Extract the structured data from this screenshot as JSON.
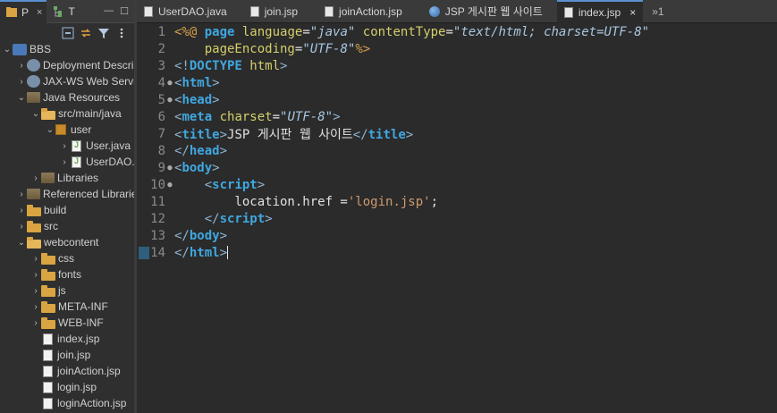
{
  "left_panel": {
    "tabs": [
      {
        "label": "P",
        "active": true,
        "close": "×"
      },
      {
        "label": "T",
        "active": false
      }
    ]
  },
  "tree": [
    {
      "label": "BBS",
      "arrow": "v",
      "icon": "project-icon",
      "indent": 0
    },
    {
      "label": "Deployment Descriptor",
      "arrow": ">",
      "icon": "deployment-icon",
      "indent": 1
    },
    {
      "label": "JAX-WS Web Services",
      "arrow": ">",
      "icon": "webservice-icon",
      "indent": 1
    },
    {
      "label": "Java Resources",
      "arrow": "v",
      "icon": "java-resources-icon",
      "indent": 1
    },
    {
      "label": "src/main/java",
      "arrow": "v",
      "icon": "source-folder-icon",
      "indent": 2
    },
    {
      "label": "user",
      "arrow": "v",
      "icon": "package-icon",
      "indent": 3
    },
    {
      "label": "User.java",
      "arrow": ">",
      "icon": "java-file-icon",
      "indent": 4
    },
    {
      "label": "UserDAO.java",
      "arrow": ">",
      "icon": "java-file-icon",
      "indent": 4
    },
    {
      "label": "Libraries",
      "arrow": ">",
      "icon": "library-icon",
      "indent": 2
    },
    {
      "label": "Referenced Libraries",
      "arrow": ">",
      "icon": "library-icon",
      "indent": 1
    },
    {
      "label": "build",
      "arrow": ">",
      "icon": "folder-icon",
      "indent": 1
    },
    {
      "label": "src",
      "arrow": ">",
      "icon": "folder-icon",
      "indent": 1
    },
    {
      "label": "webcontent",
      "arrow": "v",
      "icon": "folder-open-icon",
      "indent": 1
    },
    {
      "label": "css",
      "arrow": ">",
      "icon": "folder-icon",
      "indent": 2
    },
    {
      "label": "fonts",
      "arrow": ">",
      "icon": "folder-icon",
      "indent": 2
    },
    {
      "label": "js",
      "arrow": ">",
      "icon": "folder-icon",
      "indent": 2
    },
    {
      "label": "META-INF",
      "arrow": ">",
      "icon": "folder-icon",
      "indent": 2
    },
    {
      "label": "WEB-INF",
      "arrow": ">",
      "icon": "folder-icon",
      "indent": 2
    },
    {
      "label": "index.jsp",
      "arrow": "",
      "icon": "jsp-file-icon",
      "indent": 2
    },
    {
      "label": "join.jsp",
      "arrow": "",
      "icon": "jsp-file-icon",
      "indent": 2
    },
    {
      "label": "joinAction.jsp",
      "arrow": "",
      "icon": "jsp-file-icon",
      "indent": 2
    },
    {
      "label": "login.jsp",
      "arrow": "",
      "icon": "jsp-file-icon",
      "indent": 2
    },
    {
      "label": "loginAction.jsp",
      "arrow": "",
      "icon": "jsp-file-icon",
      "indent": 2
    }
  ],
  "editor_tabs": [
    {
      "label": "UserDAO.java",
      "icon": "java-file-icon",
      "active": false
    },
    {
      "label": "join.jsp",
      "icon": "jsp-file-icon",
      "active": false
    },
    {
      "label": "joinAction.jsp",
      "icon": "jsp-file-icon",
      "active": false
    },
    {
      "label": "JSP 게시판 웹 사이트",
      "icon": "globe-icon",
      "active": false
    },
    {
      "label": "index.jsp",
      "icon": "jsp-file-icon",
      "active": true,
      "close": "×"
    }
  ],
  "overflow_count": "»1",
  "code_lines": [
    {
      "n": "1",
      "fold": "",
      "tokens": [
        [
          "dir",
          "<%@ "
        ],
        [
          "tag",
          "page "
        ],
        [
          "attr",
          "language"
        ],
        [
          "text",
          "="
        ],
        [
          "str",
          "\"java\""
        ],
        [
          "text",
          " "
        ],
        [
          "attr",
          "contentType"
        ],
        [
          "text",
          "="
        ],
        [
          "str",
          "\"text/html; charset=UTF-8\""
        ]
      ]
    },
    {
      "n": "2",
      "fold": "",
      "tokens": [
        [
          "text",
          "    "
        ],
        [
          "attr",
          "pageEncoding"
        ],
        [
          "text",
          "="
        ],
        [
          "str",
          "\"UTF-8\""
        ],
        [
          "dir",
          "%>"
        ]
      ]
    },
    {
      "n": "3",
      "fold": "",
      "tokens": [
        [
          "brk",
          "<!"
        ],
        [
          "tag",
          "DOCTYPE "
        ],
        [
          "attr",
          "html"
        ],
        [
          "brk",
          ">"
        ]
      ]
    },
    {
      "n": "4",
      "fold": "●",
      "tokens": [
        [
          "brk",
          "<"
        ],
        [
          "tag",
          "html"
        ],
        [
          "brk",
          ">"
        ]
      ]
    },
    {
      "n": "5",
      "fold": "●",
      "tokens": [
        [
          "brk",
          "<"
        ],
        [
          "tag",
          "head"
        ],
        [
          "brk",
          ">"
        ]
      ]
    },
    {
      "n": "6",
      "fold": "",
      "tokens": [
        [
          "brk",
          "<"
        ],
        [
          "tag",
          "meta "
        ],
        [
          "attr",
          "charset"
        ],
        [
          "text",
          "="
        ],
        [
          "str",
          "\"UTF-8\""
        ],
        [
          "brk",
          ">"
        ]
      ]
    },
    {
      "n": "7",
      "fold": "",
      "tokens": [
        [
          "brk",
          "<"
        ],
        [
          "tag",
          "title"
        ],
        [
          "brk",
          ">"
        ],
        [
          "text",
          "JSP 게시판 웹 사이트"
        ],
        [
          "brk",
          "</"
        ],
        [
          "tag",
          "title"
        ],
        [
          "brk",
          ">"
        ]
      ]
    },
    {
      "n": "8",
      "fold": "",
      "tokens": [
        [
          "brk",
          "</"
        ],
        [
          "tag",
          "head"
        ],
        [
          "brk",
          ">"
        ]
      ]
    },
    {
      "n": "9",
      "fold": "●",
      "tokens": [
        [
          "brk",
          "<"
        ],
        [
          "tag",
          "body"
        ],
        [
          "brk",
          ">"
        ]
      ]
    },
    {
      "n": "10",
      "fold": "●",
      "tokens": [
        [
          "text",
          "    "
        ],
        [
          "brk",
          "<"
        ],
        [
          "tag",
          "script"
        ],
        [
          "brk",
          ">"
        ]
      ]
    },
    {
      "n": "11",
      "fold": "",
      "tokens": [
        [
          "js",
          "        location.href ="
        ],
        [
          "jsstr",
          "'login.jsp'"
        ],
        [
          "js",
          ";"
        ]
      ]
    },
    {
      "n": "12",
      "fold": "",
      "tokens": [
        [
          "text",
          "    "
        ],
        [
          "brk",
          "</"
        ],
        [
          "tag",
          "script"
        ],
        [
          "brk",
          ">"
        ]
      ]
    },
    {
      "n": "13",
      "fold": "",
      "tokens": [
        [
          "brk",
          "</"
        ],
        [
          "tag",
          "body"
        ],
        [
          "brk",
          ">"
        ]
      ]
    },
    {
      "n": "14",
      "fold": "",
      "tokens": [
        [
          "brk",
          "</"
        ],
        [
          "tag",
          "html"
        ],
        [
          "brk",
          ">"
        ]
      ]
    }
  ]
}
